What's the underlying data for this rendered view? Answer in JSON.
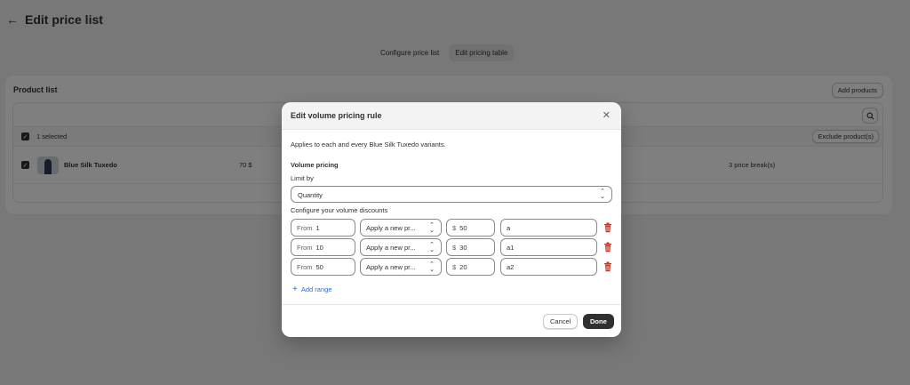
{
  "page": {
    "title": "Edit price list",
    "tabs": [
      {
        "label": "Configure price list",
        "active": false
      },
      {
        "label": "Edit pricing table",
        "active": true
      }
    ]
  },
  "product_list": {
    "title": "Product list",
    "add_products_label": "Add products",
    "selected_text": "1 selected",
    "exclude_label": "Exclude product(s)",
    "rows": [
      {
        "name": "Blue Silk Tuxedo",
        "price": "70 $",
        "breaks": "3 price break(s)"
      }
    ]
  },
  "modal": {
    "title": "Edit volume pricing rule",
    "applies_text": "Applies to each and every Blue Silk Tuxedo variants.",
    "volume_pricing_label": "Volume pricing",
    "limit_by_label": "Limit by",
    "limit_by_value": "Quantity",
    "configure_label": "Configure your volume discounts",
    "rows": [
      {
        "from_prefix": "From",
        "from": "1",
        "mode": "Apply a new pr...",
        "currency": "$",
        "amount": "50",
        "name": "a"
      },
      {
        "from_prefix": "From",
        "from": "10",
        "mode": "Apply a new pr...",
        "currency": "$",
        "amount": "30",
        "name": "a1"
      },
      {
        "from_prefix": "From",
        "from": "50",
        "mode": "Apply a new pr...",
        "currency": "$",
        "amount": "20",
        "name": "a2"
      }
    ],
    "add_range_label": "Add range",
    "cancel_label": "Cancel",
    "done_label": "Done"
  },
  "colors": {
    "overlay": "#000000",
    "primary_button": "#303030",
    "link": "#2c6ecb",
    "delete_icon": "#c0392b"
  }
}
